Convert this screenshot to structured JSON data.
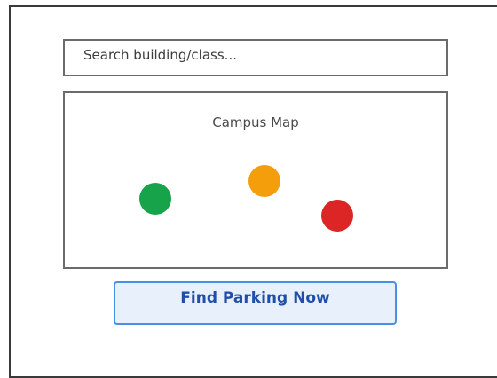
{
  "search": {
    "placeholder": "Search building/class..."
  },
  "map": {
    "title": "Campus Map",
    "markers": [
      {
        "name": "green-marker",
        "color": "#16a34a"
      },
      {
        "name": "orange-marker",
        "color": "#f59e0b"
      },
      {
        "name": "red-marker",
        "color": "#dc2626"
      }
    ]
  },
  "actions": {
    "find_parking_label": "Find Parking Now"
  },
  "colors": {
    "accent_border": "#4a8fe7",
    "accent_fill": "#e8f0fc",
    "accent_text": "#1f4fa8"
  }
}
